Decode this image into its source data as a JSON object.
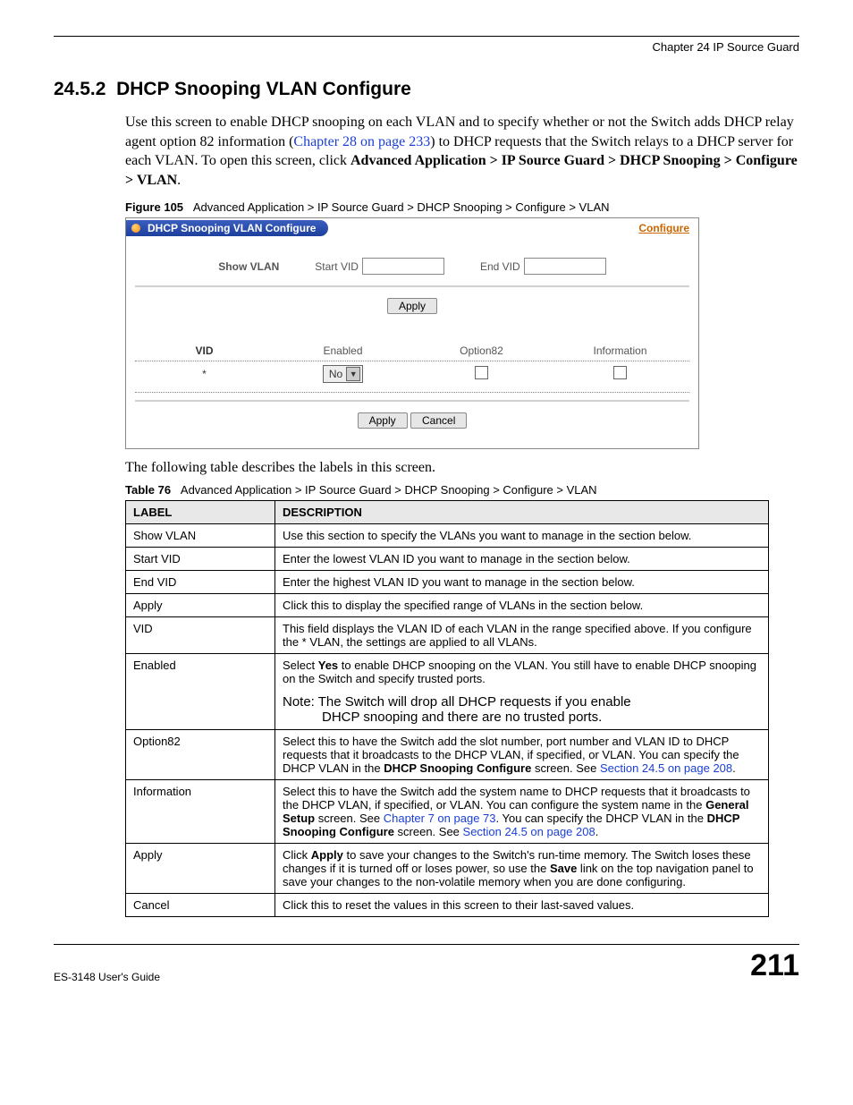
{
  "header": {
    "chapter": "Chapter 24 IP Source Guard"
  },
  "section": {
    "number": "24.5.2",
    "title": "DHCP Snooping VLAN Configure"
  },
  "intro": {
    "p1a": "Use this screen to enable DHCP snooping on each VLAN and to specify whether or not the Switch adds DHCP relay agent option 82 information (",
    "p1link": "Chapter 28 on page 233",
    "p1b": ") to DHCP requests that the Switch relays to a DHCP server for each VLAN. To open this screen, click ",
    "p1bold": "Advanced Application > IP Source Guard > DHCP Snooping > Configure > VLAN",
    "p1c": "."
  },
  "figure": {
    "label": "Figure 105",
    "caption": "Advanced Application > IP Source Guard > DHCP Snooping > Configure > VLAN"
  },
  "screenshot": {
    "tab_title": "DHCP Snooping VLAN Configure",
    "link": "Configure",
    "show_vlan": "Show VLAN",
    "start_vid": "Start VID",
    "end_vid": "End VID",
    "apply": "Apply",
    "cancel": "Cancel",
    "col_vid": "VID",
    "col_enabled": "Enabled",
    "col_option82": "Option82",
    "col_information": "Information",
    "row_vid": "*",
    "row_enabled": "No"
  },
  "between_text": "The following table describes the labels in this screen.",
  "table_caption": {
    "label": "Table 76",
    "caption": "Advanced Application > IP Source Guard > DHCP Snooping > Configure > VLAN"
  },
  "desc_table": {
    "head_label": "LABEL",
    "head_desc": "DESCRIPTION",
    "rows": [
      {
        "label": "Show VLAN",
        "desc": "Use this section to specify the VLANs you want to manage in the section below."
      },
      {
        "label": "Start VID",
        "desc": "Enter the lowest VLAN ID you want to manage in the section below."
      },
      {
        "label": "End VID",
        "desc": "Enter the highest VLAN ID you want to manage in the section below."
      },
      {
        "label": "Apply",
        "desc": "Click this to display the specified range of VLANs in the section below."
      },
      {
        "label": "VID",
        "desc": "This field displays the VLAN ID of each VLAN in the range specified above. If you configure the * VLAN, the settings are applied to all VLANs."
      }
    ],
    "enabled": {
      "label": "Enabled",
      "d1a": "Select ",
      "d1b": "Yes",
      "d1c": " to enable DHCP snooping on the VLAN. You still have to enable DHCP snooping on the Switch and specify trusted ports.",
      "note1": "Note: The Switch will drop all DHCP requests if you enable",
      "note2": "DHCP snooping and there are no trusted ports."
    },
    "option82": {
      "label": "Option82",
      "d1": "Select this to have the Switch add the slot number, port number and VLAN ID to DHCP requests that it broadcasts to the DHCP VLAN, if specified, or VLAN. You can specify the DHCP VLAN in the ",
      "d1b": "DHCP Snooping Configure",
      "d1c": " screen. See ",
      "link": "Section 24.5 on page 208",
      "d1d": "."
    },
    "information": {
      "label": "Information",
      "d1": "Select this to have the Switch add the system name to DHCP requests that it broadcasts to the DHCP VLAN, if specified, or VLAN. You can configure the system name in the ",
      "d1b": "General Setup",
      "d1c": " screen. See ",
      "link1": "Chapter 7 on page 73",
      "d1d": ". You can specify the DHCP VLAN in the ",
      "d1e": "DHCP Snooping Configure",
      "d1f": " screen. See ",
      "link2": "Section 24.5 on page 208",
      "d1g": "."
    },
    "apply2": {
      "label": "Apply",
      "d1a": "Click ",
      "d1b": "Apply",
      "d1c": " to save your changes to the Switch's run-time memory. The Switch loses these changes if it is turned off or loses power, so use the ",
      "d1d": "Save",
      "d1e": " link on the top navigation panel to save your changes to the non-volatile memory when you are done configuring."
    },
    "cancel": {
      "label": "Cancel",
      "desc": "Click this to reset the values in this screen to their last-saved values."
    }
  },
  "footer": {
    "left": "ES-3148 User's Guide",
    "right": "211"
  }
}
